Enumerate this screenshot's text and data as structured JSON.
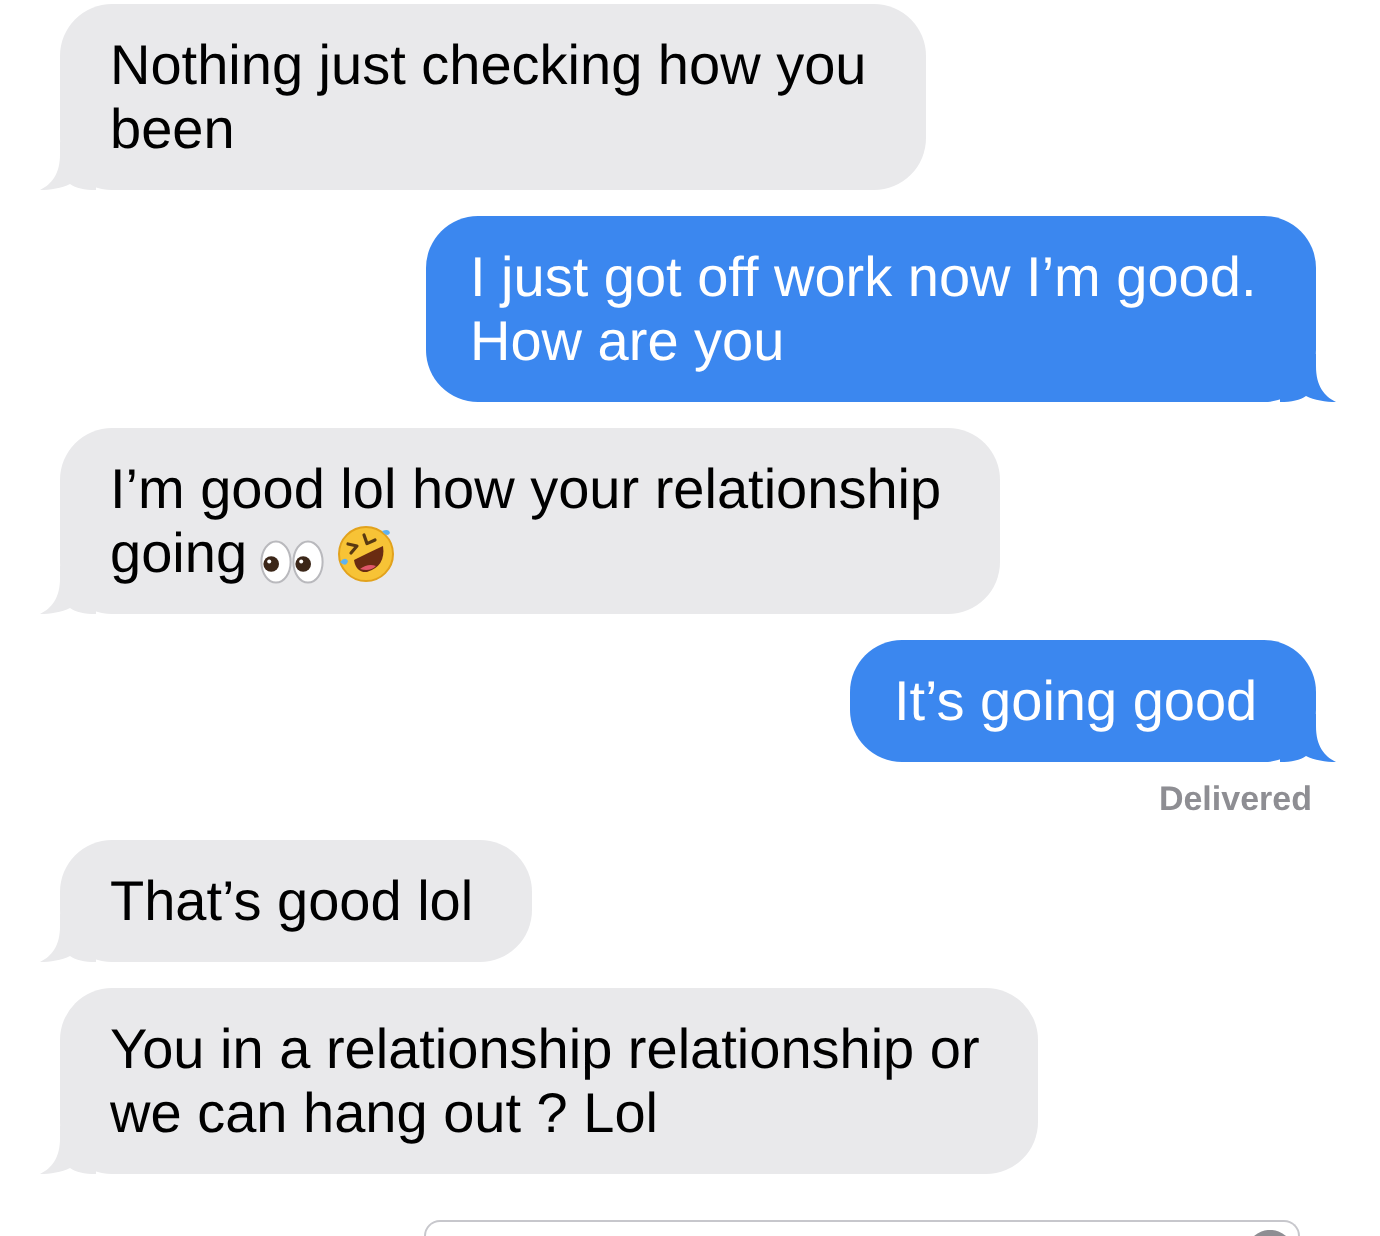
{
  "messages": [
    {
      "kind": "received",
      "text": "Nothing just checking how you been"
    },
    {
      "kind": "sent",
      "text": "I just got off work now I’m good. How are you"
    },
    {
      "kind": "received",
      "text": "I’m good lol how your relationship going",
      "icons": [
        {
          "kind": "eyes"
        },
        {
          "kind": "rofl"
        }
      ]
    },
    {
      "kind": "sent",
      "text": "It’s going good"
    },
    {
      "kind": "status",
      "text": "Delivered"
    },
    {
      "kind": "received",
      "text": "That’s good lol"
    },
    {
      "kind": "received",
      "text": "You in a relationship relationship or we can hang out ? Lol"
    }
  ]
}
